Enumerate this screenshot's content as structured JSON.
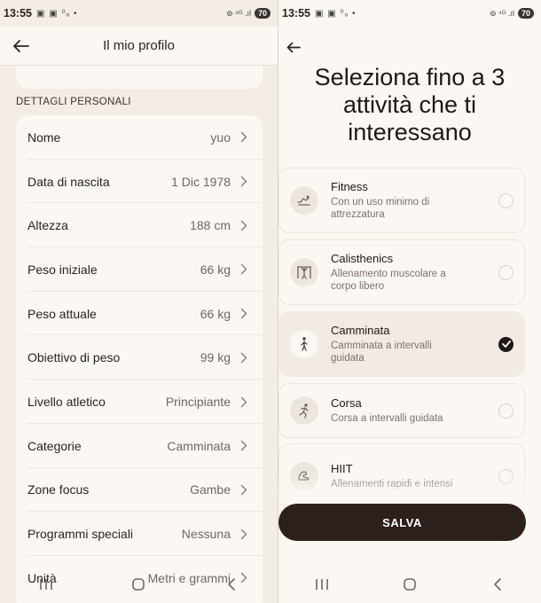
{
  "status_left": {
    "time": "13:55",
    "icons": "▣ ▣ ⁰ₒ •",
    "network": "⊚ ⁴ᴳ .ıl",
    "battery": "70"
  },
  "status_right": {
    "time": "13:55",
    "icons": "▣ ▣ ⁰ₒ •",
    "network": "⊚ ⁴ᴳ .ıl",
    "battery": "70"
  },
  "profile": {
    "title": "Il mio profilo",
    "section_label": "DETTAGLI PERSONALI",
    "rows": [
      {
        "label": "Nome",
        "value": "yuo"
      },
      {
        "label": "Data di nascita",
        "value": "1 Dic 1978"
      },
      {
        "label": "Altezza",
        "value": "188 cm"
      },
      {
        "label": "Peso iniziale",
        "value": "66 kg"
      },
      {
        "label": "Peso attuale",
        "value": "66 kg"
      },
      {
        "label": "Obiettivo di peso",
        "value": "99 kg"
      },
      {
        "label": "Livello atletico",
        "value": "Principiante"
      },
      {
        "label": "Categorie",
        "value": "Camminata"
      },
      {
        "label": "Zone focus",
        "value": "Gambe"
      },
      {
        "label": "Programmi speciali",
        "value": "Nessuna"
      },
      {
        "label": "Unità",
        "value": "Metri e grammi"
      }
    ]
  },
  "activities": {
    "heading": "Seleziona fino a 3 attività che ti interessano",
    "items": [
      {
        "title": "Fitness",
        "subtitle": "Con un uso minimo di attrezzatura",
        "icon": "fitness-icon",
        "selected": false
      },
      {
        "title": "Calisthenics",
        "subtitle": "Allenamento muscolare a corpo libero",
        "icon": "calisthenics-icon",
        "selected": false
      },
      {
        "title": "Camminata",
        "subtitle": "Camminata a intervalli guidata",
        "icon": "walking-icon",
        "selected": true
      },
      {
        "title": "Corsa",
        "subtitle": "Corsa a intervalli guidata",
        "icon": "running-icon",
        "selected": false
      },
      {
        "title": "HIIT",
        "subtitle": "Allenamenti rapidi e intensi",
        "icon": "hiit-icon",
        "selected": false
      }
    ],
    "save_label": "SALVA"
  },
  "colors": {
    "accent": "#2c201c",
    "background": "#fbf8f3",
    "panel": "#f3ede6"
  }
}
